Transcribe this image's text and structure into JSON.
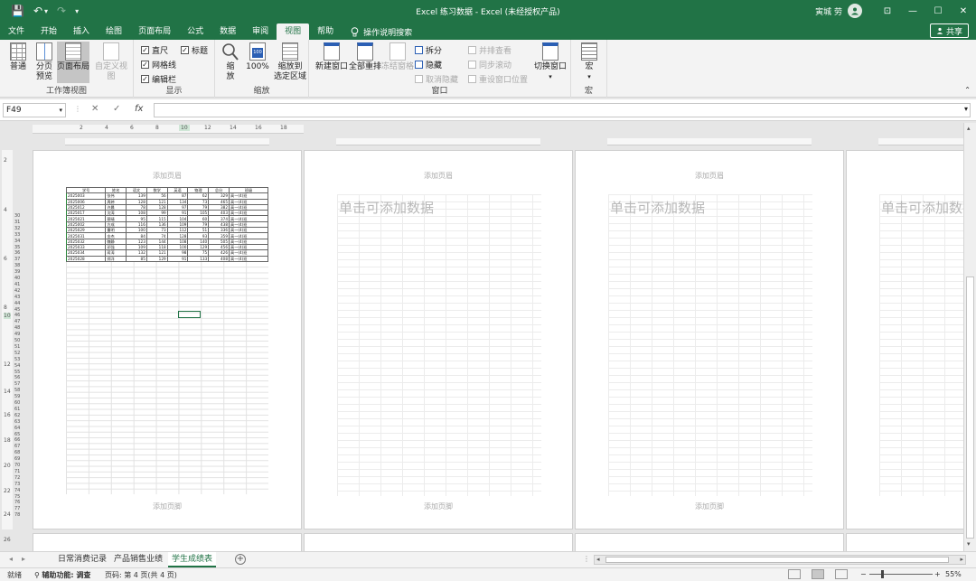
{
  "titlebar": {
    "title": "Excel 练习数据  -  Excel (未经授权产品)",
    "user": "寅城 劳",
    "avatar_icon": "user-icon",
    "qat": {
      "save": "💾",
      "undo": "↶",
      "undo_drop": "▾",
      "redo": "↷",
      "customize": "▾"
    },
    "win": {
      "ribbon_opts": "⊡",
      "minimize": "—",
      "maximize": "☐",
      "close": "✕"
    }
  },
  "tabs": [
    "文件",
    "开始",
    "插入",
    "绘图",
    "页面布局",
    "公式",
    "数据",
    "审阅",
    "视图",
    "帮助"
  ],
  "active_tab": "视图",
  "search_label": "操作说明搜索",
  "share_label": "共享",
  "ribbon": {
    "workbook_views": {
      "label": "工作簿视图",
      "normal": "普通",
      "page_break_1": "分页",
      "page_break_2": "预览",
      "page_layout": "页面布局",
      "custom": "自定义视图"
    },
    "show": {
      "label": "显示",
      "ruler": "直尺",
      "gridlines": "网格线",
      "formula_bar": "编辑栏",
      "headings": "标题",
      "check": "✓"
    },
    "zoom": {
      "label": "缩放",
      "zoom_1": "缩",
      "zoom_2": "放",
      "hundred": "100%",
      "selection_1": "缩放到",
      "selection_2": "选定区域",
      "hundred_icon_text": "100"
    },
    "window": {
      "label": "窗口",
      "new_window": "新建窗口",
      "arrange_all": "全部重排",
      "freeze": "冻结窗格",
      "split": "拆分",
      "hide": "隐藏",
      "unhide": "取消隐藏",
      "side_by_side": "并排查看",
      "sync_scroll": "同步滚动",
      "reset_pos": "重设窗口位置",
      "switch": "切换窗口",
      "switch_arrow": "▾"
    },
    "macros": {
      "label": "宏",
      "macros": "宏",
      "arrow": "▾"
    }
  },
  "formula": {
    "namebox": "F49",
    "namebox_arrow": "▾",
    "cancel": "✕",
    "enter": "✓",
    "fx": "fx",
    "expand": "▾",
    "options": "⋮"
  },
  "ruler_ticks": [
    "2",
    "4",
    "6",
    "8",
    "10",
    "12",
    "14",
    "16",
    "18"
  ],
  "vruler_ticks": [
    "2",
    "4",
    "6",
    "8",
    "10",
    "12",
    "14",
    "16",
    "18",
    "20",
    "22",
    "24",
    "26"
  ],
  "row_numbers": [
    "30",
    "31",
    "32",
    "33",
    "34",
    "35",
    "36",
    "37",
    "38",
    "39",
    "40",
    "41",
    "42",
    "43",
    "44",
    "45",
    "46",
    "47",
    "48",
    "49",
    "50",
    "51",
    "52",
    "53",
    "54",
    "55",
    "56",
    "57",
    "58",
    "59",
    "60",
    "61",
    "62",
    "63",
    "64",
    "65",
    "66",
    "67",
    "68",
    "69",
    "70",
    "71",
    "72",
    "73",
    "74",
    "75",
    "76",
    "77",
    "78"
  ],
  "pages": {
    "header_placeholder": "添加页眉",
    "footer_placeholder": "添加页脚",
    "blank_placeholder": "单击可添加数据"
  },
  "score_table": {
    "headers": [
      "学号",
      "姓名",
      "语文",
      "数学",
      "英语",
      "物理",
      "总分",
      "班级"
    ],
    "rows": [
      [
        "2025003",
        "张伟",
        "139",
        "56",
        "87",
        "62",
        "329",
        "高一(4)班"
      ],
      [
        "2025006",
        "周婷",
        "128",
        "121",
        "134",
        "73",
        "465",
        "高一(4)班"
      ],
      [
        "2025012",
        "许晨",
        "78",
        "128",
        "97",
        "79",
        "382",
        "高一(4)班"
      ],
      [
        "2025017",
        "沈涛",
        "108",
        "99",
        "91",
        "105",
        "403",
        "高一(4)班"
      ],
      [
        "2025021",
        "蔡晴",
        "95",
        "115",
        "104",
        "60",
        "374",
        "高一(4)班"
      ],
      [
        "2025002",
        "方成",
        "116",
        "136",
        "109",
        "79",
        "438",
        "高一(4)班"
      ],
      [
        "2025029",
        "曹明",
        "100",
        "73",
        "112",
        "51",
        "336",
        "高一(4)班"
      ],
      [
        "2025031",
        "金杰",
        "84",
        "74",
        "128",
        "93",
        "359",
        "高一(4)班"
      ],
      [
        "2025032",
        "魏静",
        "123",
        "144",
        "108",
        "140",
        "505",
        "高一(4)班"
      ],
      [
        "2025033",
        "邓强",
        "109",
        "118",
        "100",
        "129",
        "456",
        "高一(4)班"
      ],
      [
        "2025034",
        "蒋涛",
        "132",
        "121",
        "98",
        "75",
        "426",
        "高一(4)班"
      ],
      [
        "2025028",
        "郑洋",
        "85",
        "129",
        "91",
        "133",
        "408",
        "高一(4)班"
      ]
    ]
  },
  "sheets": [
    "日常消费记录",
    "产品销售业绩",
    "学生成绩表"
  ],
  "active_sheet": "学生成绩表",
  "sheet_nav": {
    "prev": "◂",
    "next": "▸",
    "add": "+"
  },
  "scroll": {
    "up": "▴",
    "down": "▾",
    "left": "◂",
    "right": "▸"
  },
  "status": {
    "ready": "就绪",
    "accessibility": "辅助功能: 调查",
    "page_info": "页码: 第 4 页(共 4 页)",
    "zoom_minus": "−",
    "zoom_plus": "+",
    "zoom": "55%"
  }
}
